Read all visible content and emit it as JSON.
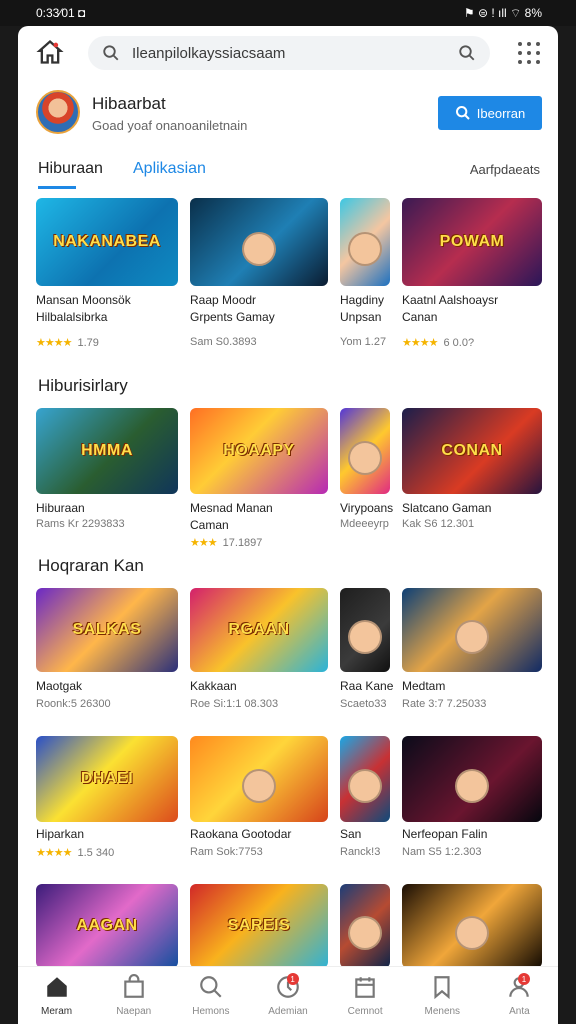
{
  "status": {
    "time": "0:33⁄01 ◘",
    "right": "⚑ ⊜ ! ıll ⌔ 8%"
  },
  "search": {
    "placeholder": "Ileanpilolkayssiacsaam"
  },
  "profile": {
    "name": "Hibaarbat",
    "subtitle": "Goad yoaf onanoaniletnain",
    "cta": "Ibeorran"
  },
  "tabs": {
    "active": "Hiburaan",
    "inactive": "Aplikasian",
    "right": "Aarfpdaeats"
  },
  "row1": [
    {
      "art": "NAKANABEA",
      "name": "Mansan Moonsök\nHilbalalsibrka",
      "meta": "★★★★ 1.79"
    },
    {
      "art": "",
      "name": "Raap Moodr\nGrpents Gamay",
      "meta": "Sam S0.3893"
    },
    {
      "art": "",
      "name": "Hagdiny\nUnpsan",
      "meta": "Yom 1.27"
    },
    {
      "art": "POWAM",
      "name": "Kaatnl Aalshoaysr\nCanan",
      "meta": "★★★★ 6 0.0?"
    }
  ],
  "section2": "Hiburisirlary",
  "row2": [
    {
      "art": "HMMA",
      "name": "Hiburaan",
      "meta": "Rams Kr 2293833"
    },
    {
      "art": "HOAAPY",
      "name": "Mesnad Manan\nCaman",
      "meta": "★★★ 17.1897"
    },
    {
      "art": "",
      "name": "Virypoans",
      "meta": "Mdeeeyrp"
    },
    {
      "art": "CONAN",
      "name": "Slatcano Gaman",
      "meta": "Kak S6 12.301"
    }
  ],
  "section3": "Hoqraran Kan",
  "row3": [
    {
      "art": "SALKAS",
      "name": "Maotgak",
      "meta": "Roonk:5 26300"
    },
    {
      "art": "RGAAN",
      "name": "Kakkaan",
      "meta": "Roe Si:1:1 08.303"
    },
    {
      "art": "",
      "name": "Raa Kane",
      "meta": "Scaeto33"
    },
    {
      "art": "",
      "name": "Medtam",
      "meta": "Rate 3:7 7.25033"
    }
  ],
  "row4": [
    {
      "art": "DHAEI",
      "name": "Hiparkan",
      "meta": "★★★★ 1.5 340"
    },
    {
      "art": "",
      "name": "Raokana Gootodar",
      "meta": "Ram Sok:7753"
    },
    {
      "art": "",
      "name": "San",
      "meta": "Ranck!3"
    },
    {
      "art": "",
      "name": "Nerfeopan Falin",
      "meta": "Nam S5 1:2.303"
    }
  ],
  "row5": [
    {
      "art": "AAGAN"
    },
    {
      "art": "SAREIS"
    },
    {
      "art": ""
    },
    {
      "art": ""
    }
  ],
  "nav": [
    {
      "label": "Meram"
    },
    {
      "label": "Naepan"
    },
    {
      "label": "Hemons"
    },
    {
      "label": "Ademian",
      "badge": "1"
    },
    {
      "label": "Cemnot"
    },
    {
      "label": "Menens"
    },
    {
      "label": "Anta",
      "badge": "1"
    }
  ]
}
